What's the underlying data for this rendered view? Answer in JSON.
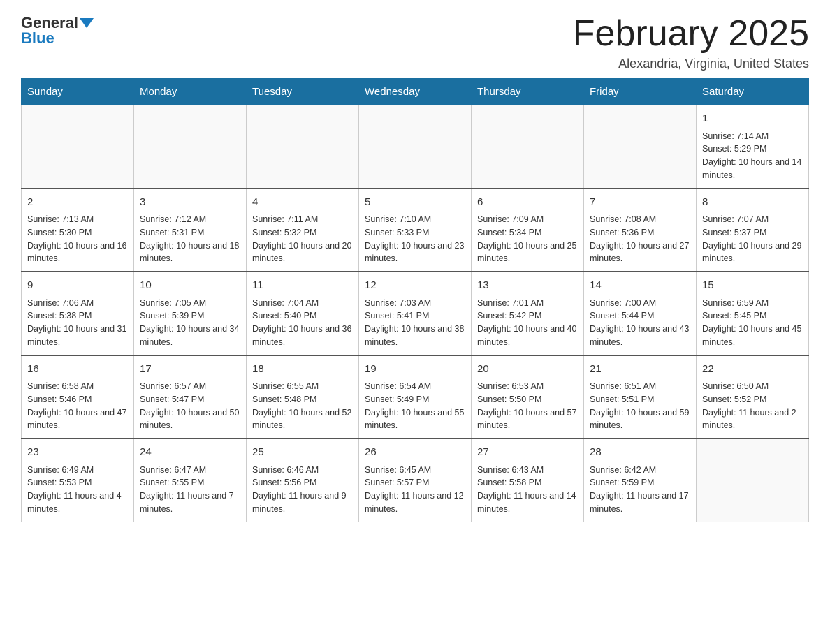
{
  "header": {
    "logo_line1": "General",
    "logo_line2": "Blue",
    "month_title": "February 2025",
    "subtitle": "Alexandria, Virginia, United States"
  },
  "weekdays": [
    "Sunday",
    "Monday",
    "Tuesday",
    "Wednesday",
    "Thursday",
    "Friday",
    "Saturday"
  ],
  "weeks": [
    [
      {
        "day": "",
        "info": ""
      },
      {
        "day": "",
        "info": ""
      },
      {
        "day": "",
        "info": ""
      },
      {
        "day": "",
        "info": ""
      },
      {
        "day": "",
        "info": ""
      },
      {
        "day": "",
        "info": ""
      },
      {
        "day": "1",
        "info": "Sunrise: 7:14 AM\nSunset: 5:29 PM\nDaylight: 10 hours and 14 minutes."
      }
    ],
    [
      {
        "day": "2",
        "info": "Sunrise: 7:13 AM\nSunset: 5:30 PM\nDaylight: 10 hours and 16 minutes."
      },
      {
        "day": "3",
        "info": "Sunrise: 7:12 AM\nSunset: 5:31 PM\nDaylight: 10 hours and 18 minutes."
      },
      {
        "day": "4",
        "info": "Sunrise: 7:11 AM\nSunset: 5:32 PM\nDaylight: 10 hours and 20 minutes."
      },
      {
        "day": "5",
        "info": "Sunrise: 7:10 AM\nSunset: 5:33 PM\nDaylight: 10 hours and 23 minutes."
      },
      {
        "day": "6",
        "info": "Sunrise: 7:09 AM\nSunset: 5:34 PM\nDaylight: 10 hours and 25 minutes."
      },
      {
        "day": "7",
        "info": "Sunrise: 7:08 AM\nSunset: 5:36 PM\nDaylight: 10 hours and 27 minutes."
      },
      {
        "day": "8",
        "info": "Sunrise: 7:07 AM\nSunset: 5:37 PM\nDaylight: 10 hours and 29 minutes."
      }
    ],
    [
      {
        "day": "9",
        "info": "Sunrise: 7:06 AM\nSunset: 5:38 PM\nDaylight: 10 hours and 31 minutes."
      },
      {
        "day": "10",
        "info": "Sunrise: 7:05 AM\nSunset: 5:39 PM\nDaylight: 10 hours and 34 minutes."
      },
      {
        "day": "11",
        "info": "Sunrise: 7:04 AM\nSunset: 5:40 PM\nDaylight: 10 hours and 36 minutes."
      },
      {
        "day": "12",
        "info": "Sunrise: 7:03 AM\nSunset: 5:41 PM\nDaylight: 10 hours and 38 minutes."
      },
      {
        "day": "13",
        "info": "Sunrise: 7:01 AM\nSunset: 5:42 PM\nDaylight: 10 hours and 40 minutes."
      },
      {
        "day": "14",
        "info": "Sunrise: 7:00 AM\nSunset: 5:44 PM\nDaylight: 10 hours and 43 minutes."
      },
      {
        "day": "15",
        "info": "Sunrise: 6:59 AM\nSunset: 5:45 PM\nDaylight: 10 hours and 45 minutes."
      }
    ],
    [
      {
        "day": "16",
        "info": "Sunrise: 6:58 AM\nSunset: 5:46 PM\nDaylight: 10 hours and 47 minutes."
      },
      {
        "day": "17",
        "info": "Sunrise: 6:57 AM\nSunset: 5:47 PM\nDaylight: 10 hours and 50 minutes."
      },
      {
        "day": "18",
        "info": "Sunrise: 6:55 AM\nSunset: 5:48 PM\nDaylight: 10 hours and 52 minutes."
      },
      {
        "day": "19",
        "info": "Sunrise: 6:54 AM\nSunset: 5:49 PM\nDaylight: 10 hours and 55 minutes."
      },
      {
        "day": "20",
        "info": "Sunrise: 6:53 AM\nSunset: 5:50 PM\nDaylight: 10 hours and 57 minutes."
      },
      {
        "day": "21",
        "info": "Sunrise: 6:51 AM\nSunset: 5:51 PM\nDaylight: 10 hours and 59 minutes."
      },
      {
        "day": "22",
        "info": "Sunrise: 6:50 AM\nSunset: 5:52 PM\nDaylight: 11 hours and 2 minutes."
      }
    ],
    [
      {
        "day": "23",
        "info": "Sunrise: 6:49 AM\nSunset: 5:53 PM\nDaylight: 11 hours and 4 minutes."
      },
      {
        "day": "24",
        "info": "Sunrise: 6:47 AM\nSunset: 5:55 PM\nDaylight: 11 hours and 7 minutes."
      },
      {
        "day": "25",
        "info": "Sunrise: 6:46 AM\nSunset: 5:56 PM\nDaylight: 11 hours and 9 minutes."
      },
      {
        "day": "26",
        "info": "Sunrise: 6:45 AM\nSunset: 5:57 PM\nDaylight: 11 hours and 12 minutes."
      },
      {
        "day": "27",
        "info": "Sunrise: 6:43 AM\nSunset: 5:58 PM\nDaylight: 11 hours and 14 minutes."
      },
      {
        "day": "28",
        "info": "Sunrise: 6:42 AM\nSunset: 5:59 PM\nDaylight: 11 hours and 17 minutes."
      },
      {
        "day": "",
        "info": ""
      }
    ]
  ]
}
